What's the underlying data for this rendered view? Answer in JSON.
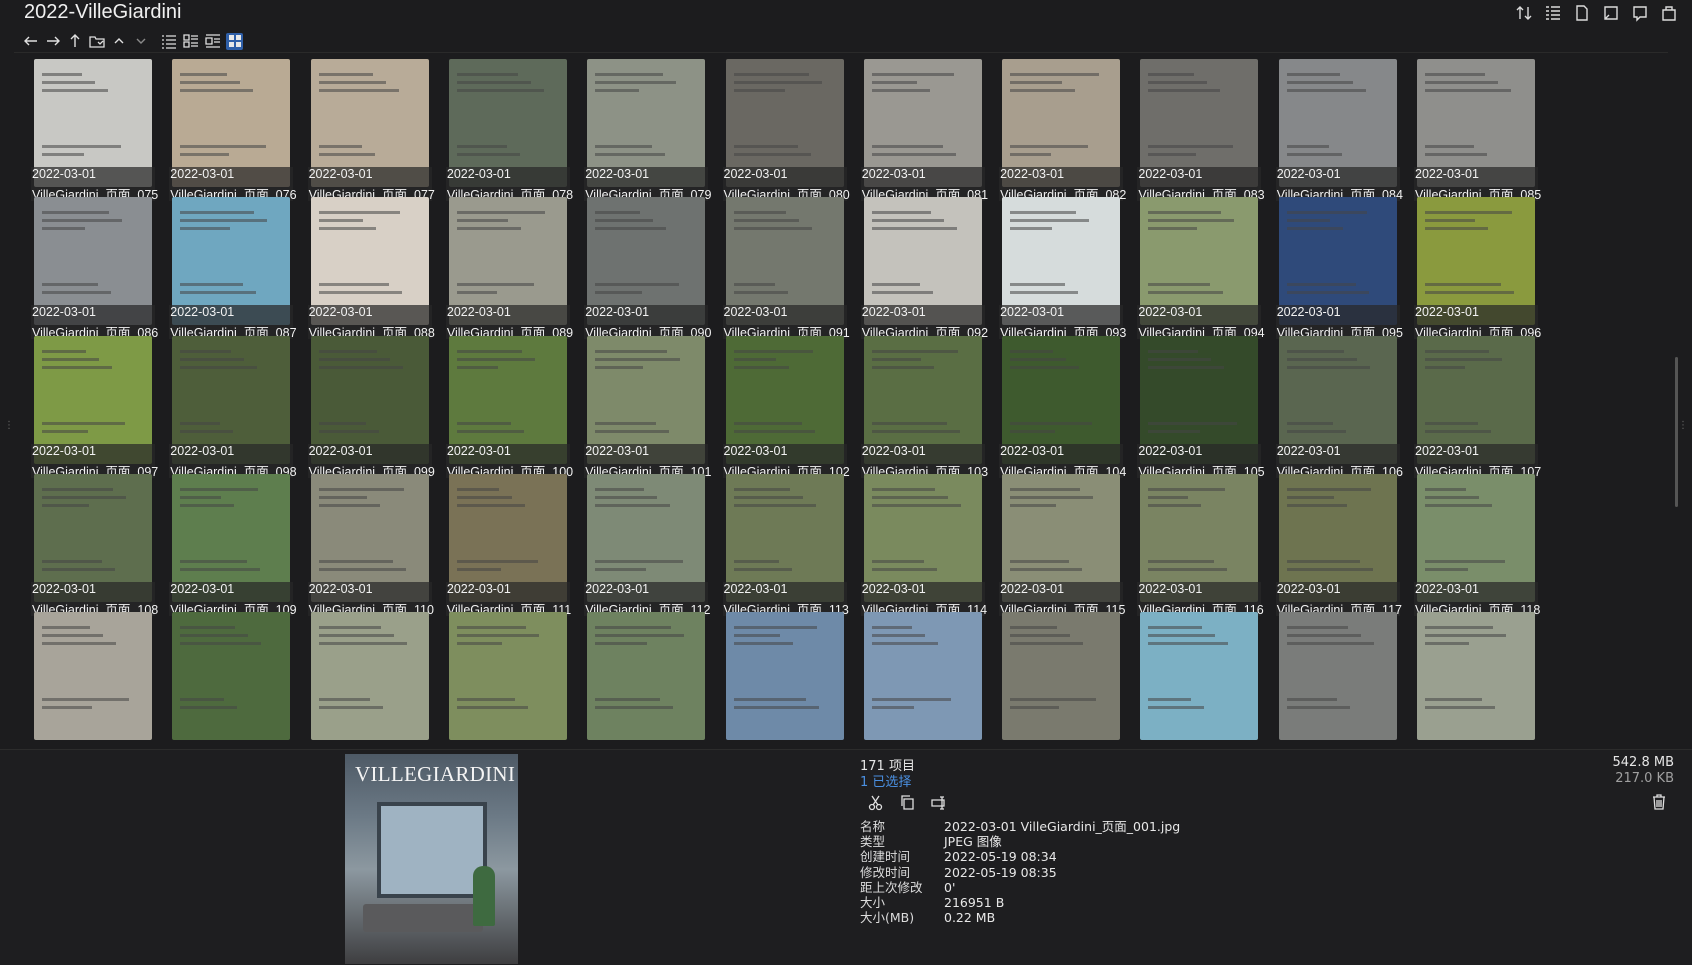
{
  "window": {
    "title": "2022-VilleGiardini"
  },
  "toolbar": {
    "right_icons": [
      "sort-icon",
      "details-list-icon",
      "page-icon",
      "panel-icon",
      "preview-pane-icon",
      "bag-icon"
    ],
    "nav_icons": [
      "back-arrow-icon",
      "forward-arrow-icon",
      "up-arrow-icon",
      "folder-icon",
      "chevron-up-icon",
      "chevron-down-icon",
      "list-view-icon",
      "details-view-icon",
      "tiles-view-icon",
      "thumbnails-view-icon"
    ]
  },
  "files": [
    {
      "date": "2022-03-01",
      "name": "VilleGiardini_页面_075",
      "color": "#c8c8c4"
    },
    {
      "date": "2022-03-01",
      "name": "VilleGiardini_页面_076",
      "color": "#b9aa94"
    },
    {
      "date": "2022-03-01",
      "name": "VilleGiardini_页面_077",
      "color": "#b8ab98"
    },
    {
      "date": "2022-03-01",
      "name": "VilleGiardini_页面_078",
      "color": "#5e6a5a"
    },
    {
      "date": "2022-03-01",
      "name": "VilleGiardini_页面_079",
      "color": "#8d9286"
    },
    {
      "date": "2022-03-01",
      "name": "VilleGiardini_页面_080",
      "color": "#6a6862"
    },
    {
      "date": "2022-03-01",
      "name": "VilleGiardini_页面_081",
      "color": "#9a9892"
    },
    {
      "date": "2022-03-01",
      "name": "VilleGiardini_页面_082",
      "color": "#a89e8e"
    },
    {
      "date": "2022-03-01",
      "name": "VilleGiardini_页面_083",
      "color": "#6f6e6a"
    },
    {
      "date": "2022-03-01",
      "name": "VilleGiardini_页面_084",
      "color": "#86888a"
    },
    {
      "date": "2022-03-01",
      "name": "VilleGiardini_页面_085",
      "color": "#8f8f8c"
    },
    {
      "date": "2022-03-01",
      "name": "VilleGiardini_页面_086",
      "color": "#8a8e92"
    },
    {
      "date": "2022-03-01",
      "name": "VilleGiardini_页面_087",
      "color": "#6fa7c0"
    },
    {
      "date": "2022-03-01",
      "name": "VilleGiardini_页面_088",
      "color": "#d8d0c6"
    },
    {
      "date": "2022-03-01",
      "name": "VilleGiardini_页面_089",
      "color": "#9a9a8e"
    },
    {
      "date": "2022-03-01",
      "name": "VilleGiardini_页面_090",
      "color": "#6e7270"
    },
    {
      "date": "2022-03-01",
      "name": "VilleGiardini_页面_091",
      "color": "#74786e"
    },
    {
      "date": "2022-03-01",
      "name": "VilleGiardini_页面_092",
      "color": "#c4c2bc"
    },
    {
      "date": "2022-03-01",
      "name": "VilleGiardini_页面_093",
      "color": "#d6dcdc"
    },
    {
      "date": "2022-03-01",
      "name": "VilleGiardini_页面_094",
      "color": "#8a9a6e"
    },
    {
      "date": "2022-03-01",
      "name": "VilleGiardini_页面_095",
      "color": "#2f4a7a"
    },
    {
      "date": "2022-03-01",
      "name": "VilleGiardini_页面_096",
      "color": "#8a9a3e"
    },
    {
      "date": "2022-03-01",
      "name": "VilleGiardini_页面_097",
      "color": "#7e9a46"
    },
    {
      "date": "2022-03-01",
      "name": "VilleGiardini_页面_098",
      "color": "#4e5e3a"
    },
    {
      "date": "2022-03-01",
      "name": "VilleGiardini_页面_099",
      "color": "#4a5a38"
    },
    {
      "date": "2022-03-01",
      "name": "VilleGiardini_页面_100",
      "color": "#5e7a3e"
    },
    {
      "date": "2022-03-01",
      "name": "VilleGiardini_页面_101",
      "color": "#7e8a6a"
    },
    {
      "date": "2022-03-01",
      "name": "VilleGiardini_页面_102",
      "color": "#4e6a36"
    },
    {
      "date": "2022-03-01",
      "name": "VilleGiardini_页面_103",
      "color": "#5a6e44"
    },
    {
      "date": "2022-03-01",
      "name": "VilleGiardini_页面_104",
      "color": "#3e5a2e"
    },
    {
      "date": "2022-03-01",
      "name": "VilleGiardini_页面_105",
      "color": "#344a2a"
    },
    {
      "date": "2022-03-01",
      "name": "VilleGiardini_页面_106",
      "color": "#5a6650"
    },
    {
      "date": "2022-03-01",
      "name": "VilleGiardini_页面_107",
      "color": "#5a6a4a"
    },
    {
      "date": "2022-03-01",
      "name": "VilleGiardini_页面_108",
      "color": "#5e6e4e"
    },
    {
      "date": "2022-03-01",
      "name": "VilleGiardini_页面_109",
      "color": "#5e7e4e"
    },
    {
      "date": "2022-03-01",
      "name": "VilleGiardini_页面_110",
      "color": "#8a8a7a"
    },
    {
      "date": "2022-03-01",
      "name": "VilleGiardini_页面_111",
      "color": "#7a7256"
    },
    {
      "date": "2022-03-01",
      "name": "VilleGiardini_页面_112",
      "color": "#7e8a76"
    },
    {
      "date": "2022-03-01",
      "name": "VilleGiardini_页面_113",
      "color": "#6e7a56"
    },
    {
      "date": "2022-03-01",
      "name": "VilleGiardini_页面_114",
      "color": "#7a8a5e"
    },
    {
      "date": "2022-03-01",
      "name": "VilleGiardini_页面_115",
      "color": "#8a8e76"
    },
    {
      "date": "2022-03-01",
      "name": "VilleGiardini_页面_116",
      "color": "#7a8462"
    },
    {
      "date": "2022-03-01",
      "name": "VilleGiardini_页面_117",
      "color": "#6e7450"
    },
    {
      "date": "2022-03-01",
      "name": "VilleGiardini_页面_118",
      "color": "#7a8e6a"
    },
    {
      "date": "",
      "name": "",
      "color": "#a8a49a"
    },
    {
      "date": "",
      "name": "",
      "color": "#4e6a3e"
    },
    {
      "date": "",
      "name": "",
      "color": "#9aa08a"
    },
    {
      "date": "",
      "name": "",
      "color": "#7e8e5e"
    },
    {
      "date": "",
      "name": "",
      "color": "#6e8260"
    },
    {
      "date": "",
      "name": "",
      "color": "#6e8aa8"
    },
    {
      "date": "",
      "name": "",
      "color": "#7e98b4"
    },
    {
      "date": "",
      "name": "",
      "color": "#7a7a6e"
    },
    {
      "date": "",
      "name": "",
      "color": "#7cb0c4"
    },
    {
      "date": "",
      "name": "",
      "color": "#7a7c7a"
    },
    {
      "date": "",
      "name": "",
      "color": "#9aa090"
    }
  ],
  "status": {
    "item_count": "171 项目",
    "selected_count": "1 已选择",
    "total_size": "542.8 MB",
    "selected_size": "217.0 KB"
  },
  "preview": {
    "masthead": "VILLEGIARDINI"
  },
  "file_actions": {
    "icons": [
      "cut-icon",
      "copy-icon",
      "rename-icon"
    ]
  },
  "properties": [
    {
      "key": "名称",
      "value": "2022-03-01 VilleGiardini_页面_001.jpg"
    },
    {
      "key": "类型",
      "value": "JPEG 图像"
    },
    {
      "key": "创建时间",
      "value": "2022-05-19  08:34"
    },
    {
      "key": "修改时间",
      "value": "2022-05-19  08:35"
    },
    {
      "key": "距上次修改",
      "value": "0'"
    },
    {
      "key": "大小",
      "value": "216951 B"
    },
    {
      "key": "大小(MB)",
      "value": "0.22 MB"
    }
  ]
}
